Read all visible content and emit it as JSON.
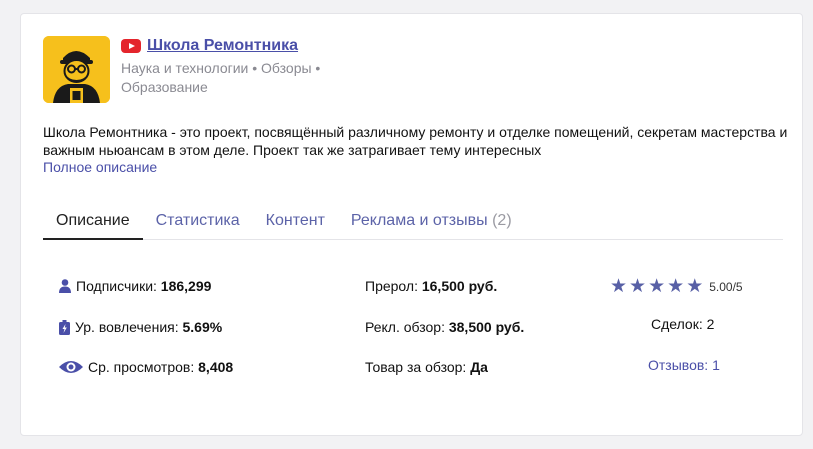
{
  "channel": {
    "title": "Школа Ремонтника",
    "subtitle": "Наука и технологии • Обзоры • Образование",
    "description": "Школа Ремонтника - это проект, посвящённый различному ремонту и отделке помещений, секретам мастерства и важным ньюансам в этом деле. Проект так же затрагивает тему интересных",
    "more_link": "Полное описание"
  },
  "tabs": [
    {
      "label": "Описание",
      "count": ""
    },
    {
      "label": "Статистика",
      "count": ""
    },
    {
      "label": "Контент",
      "count": ""
    },
    {
      "label": "Реклама и отзывы",
      "count": "(2)"
    }
  ],
  "stats": {
    "subscribers_label": "Подписчики:",
    "subscribers_value": "186,299",
    "engagement_label": "Ур. вовлечения:",
    "engagement_value": "5.69%",
    "views_label": "Ср. просмотров:",
    "views_value": "8,408",
    "preroll_label": "Прерол:",
    "preroll_value": "16,500 руб.",
    "review_label": "Рекл. обзор:",
    "review_value": "38,500 руб.",
    "product_label": "Товар за обзор:",
    "product_value": "Да",
    "rating": 5.0,
    "rating_text": "5.00/5",
    "deals_text": "Сделок: 2",
    "reviews_link": "Отзывов: 1"
  },
  "icons": {
    "subscribers": "user-icon",
    "engagement": "battery-icon",
    "views": "eye-icon",
    "youtube": "youtube-icon"
  },
  "colors": {
    "accent": "#4a4fa8",
    "avatar_bg": "#f6c01c",
    "youtube_red": "#e4252c",
    "star": "#5860a6"
  }
}
